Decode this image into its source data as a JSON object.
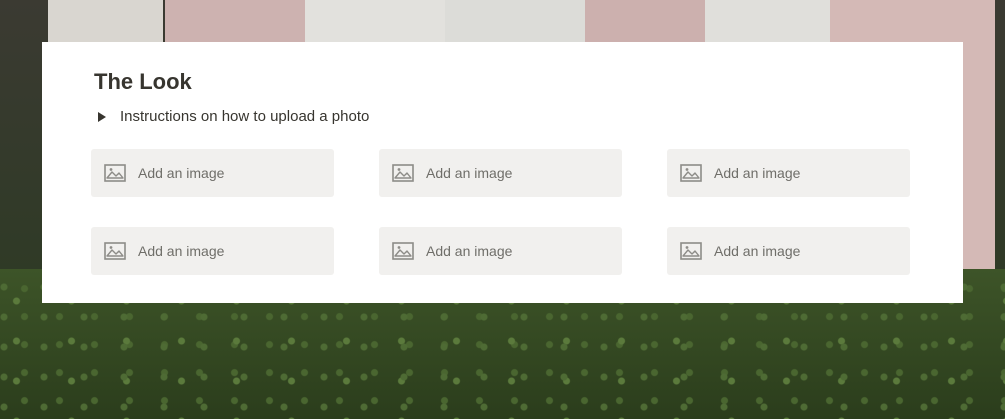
{
  "section": {
    "title": "The Look",
    "toggle_label": "Instructions on how to upload a photo"
  },
  "image_slots": [
    {
      "label": "Add an image",
      "icon": "image-icon"
    },
    {
      "label": "Add an image",
      "icon": "image-icon"
    },
    {
      "label": "Add an image",
      "icon": "image-icon"
    },
    {
      "label": "Add an image",
      "icon": "image-icon"
    },
    {
      "label": "Add an image",
      "icon": "image-icon"
    },
    {
      "label": "Add an image",
      "icon": "image-icon"
    }
  ],
  "colors": {
    "card_background": "#ffffff",
    "slot_background": "#f1f0ee",
    "text_primary": "#37352f",
    "text_muted": "#6f6e69"
  }
}
